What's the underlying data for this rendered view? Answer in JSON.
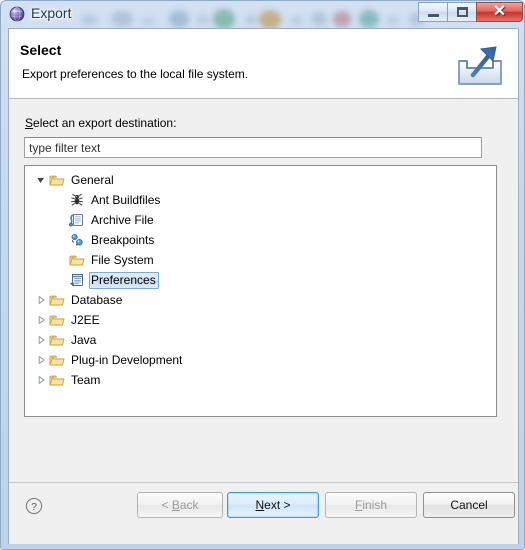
{
  "window": {
    "title": "Export",
    "icon": "eclipse-globe-icon",
    "controls": {
      "minimize": "minimize-icon",
      "maximize": "maximize-icon",
      "close": "✕"
    }
  },
  "header": {
    "title": "Select",
    "description": "Export preferences to the local file system.",
    "icon": "export-wizard-icon"
  },
  "body": {
    "destination_label_prefix": "S",
    "destination_label_rest": "elect an export destination:",
    "filter": {
      "value": "",
      "placeholder": "type filter text"
    }
  },
  "tree": {
    "nodes": [
      {
        "label": "General",
        "level": 0,
        "expanded": true,
        "icon": "folder-icon",
        "selected": false
      },
      {
        "label": "Ant Buildfiles",
        "level": 1,
        "expanded": null,
        "icon": "ant-icon",
        "selected": false
      },
      {
        "label": "Archive File",
        "level": 1,
        "expanded": null,
        "icon": "archive-file-icon",
        "selected": false
      },
      {
        "label": "Breakpoints",
        "level": 1,
        "expanded": null,
        "icon": "breakpoints-icon",
        "selected": false
      },
      {
        "label": "File System",
        "level": 1,
        "expanded": null,
        "icon": "folder-icon",
        "selected": false
      },
      {
        "label": "Preferences",
        "level": 1,
        "expanded": null,
        "icon": "preferences-icon",
        "selected": true
      },
      {
        "label": "Database",
        "level": 0,
        "expanded": false,
        "icon": "folder-icon",
        "selected": false
      },
      {
        "label": "J2EE",
        "level": 0,
        "expanded": false,
        "icon": "folder-icon",
        "selected": false
      },
      {
        "label": "Java",
        "level": 0,
        "expanded": false,
        "icon": "folder-icon",
        "selected": false
      },
      {
        "label": "Plug-in Development",
        "level": 0,
        "expanded": false,
        "icon": "folder-icon",
        "selected": false
      },
      {
        "label": "Team",
        "level": 0,
        "expanded": false,
        "icon": "folder-icon",
        "selected": false
      }
    ]
  },
  "buttons": {
    "help": "help-icon",
    "back": {
      "label": "< Back",
      "mnemonic": "B",
      "enabled": false,
      "default": false
    },
    "next": {
      "label": "Next >",
      "mnemonic": "N",
      "enabled": true,
      "default": true
    },
    "finish": {
      "label": "Finish",
      "mnemonic": "F",
      "enabled": false,
      "default": false
    },
    "cancel": {
      "label": "Cancel",
      "mnemonic": "",
      "enabled": true,
      "default": false
    }
  },
  "colors": {
    "accent_blue": "#3c9ad4",
    "selection_blue": "#c4dcf5",
    "folder_yellow": "#f5c860",
    "close_red": "#c8312b",
    "title_text": "#20395c"
  }
}
